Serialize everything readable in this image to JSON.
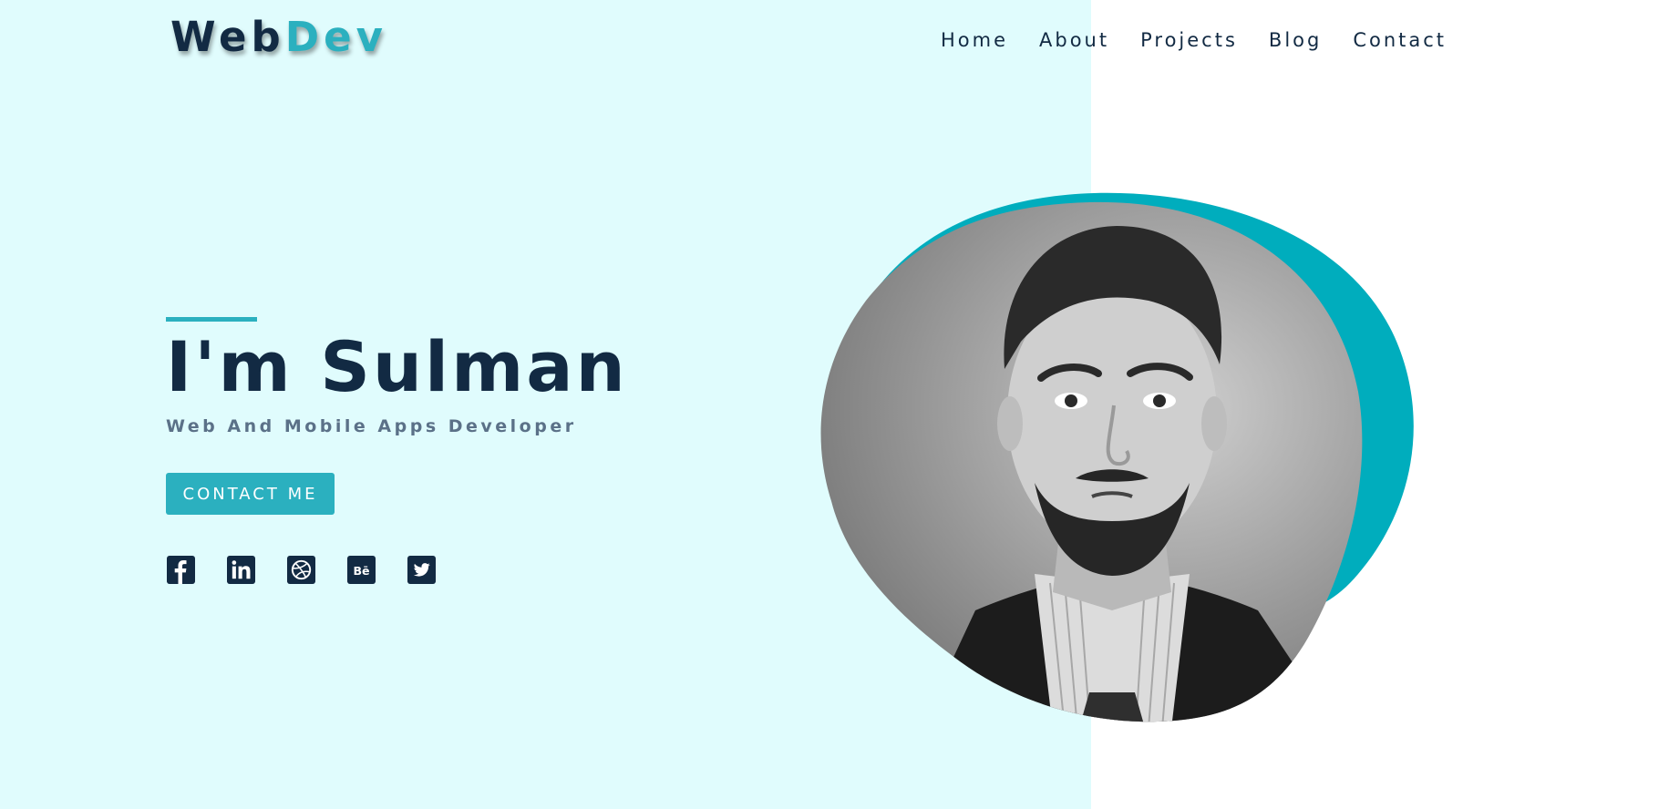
{
  "brand": {
    "part1": "Web",
    "part2": "Dev"
  },
  "nav": [
    {
      "label": "Home"
    },
    {
      "label": "About"
    },
    {
      "label": "Projects"
    },
    {
      "label": "Blog"
    },
    {
      "label": "Contact"
    }
  ],
  "hero": {
    "title": "I'm Sulman",
    "subtitle": "Web And Mobile Apps Developer",
    "button_label": "CONTACT ME"
  },
  "socials": [
    {
      "icon": "facebook-icon"
    },
    {
      "icon": "linkedin-icon"
    },
    {
      "icon": "dribbble-icon"
    },
    {
      "icon": "behance-icon"
    },
    {
      "icon": "twitter-icon"
    }
  ],
  "colors": {
    "accent": "#2bb0bf",
    "navy": "#122a43",
    "hero_bg": "#e0fcfd",
    "blob": "#00adbd"
  }
}
